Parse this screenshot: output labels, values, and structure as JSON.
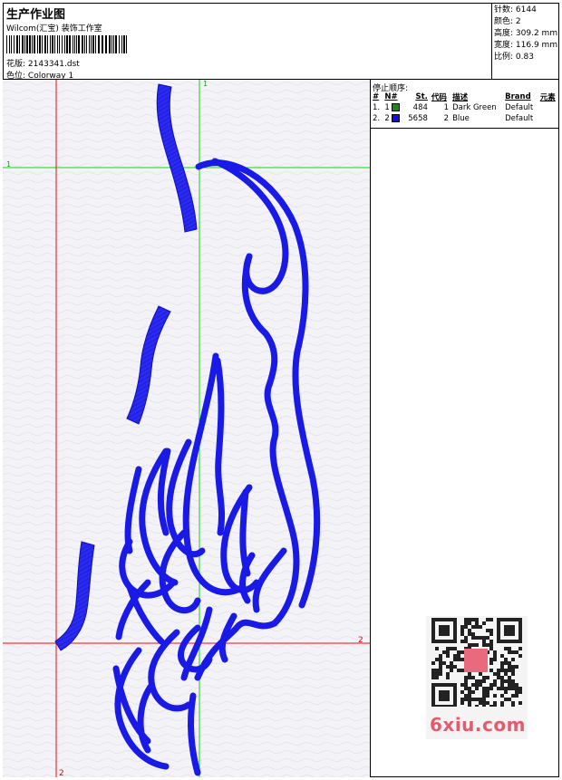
{
  "header": {
    "title": "生产作业图",
    "company": "Wilcom(汇宝) 装饰工作室",
    "design_label": "花版:",
    "design_value": "2143341.dst",
    "colorway_label": "色位:",
    "colorway_value": "Colorway 1"
  },
  "stats": [
    {
      "label": "针数:",
      "value": "6144"
    },
    {
      "label": "颜色:",
      "value": "2"
    },
    {
      "label": "高度:",
      "value": "309.2 mm"
    },
    {
      "label": "宽度:",
      "value": "116.9 mm"
    },
    {
      "label": "比例:",
      "value": "0.83"
    }
  ],
  "stop_sequence": {
    "title": "停止顺序:",
    "headers": [
      "#",
      "N#",
      "St.",
      "代码",
      "描述",
      "Brand",
      "元素"
    ],
    "rows": [
      {
        "index": "1.",
        "needle": "1",
        "color": "#1a8a1a",
        "stitches": "484",
        "code": "1",
        "description": "Dark Green",
        "brand": "Default",
        "element": ""
      },
      {
        "index": "2.",
        "needle": "2",
        "color": "#1010d8",
        "stitches": "5658",
        "code": "2",
        "description": "Blue",
        "brand": "Default",
        "element": ""
      }
    ]
  },
  "canvas": {
    "green_marker_v": "1",
    "green_marker_h": "1",
    "red_marker_h": "2",
    "red_marker_v": "2",
    "guide_green": "#19d219",
    "guide_red": "#e01010",
    "stitch_blue": "#1a1ae6"
  },
  "watermark": {
    "text": "6xiu.com",
    "color": "#e45b6e"
  }
}
